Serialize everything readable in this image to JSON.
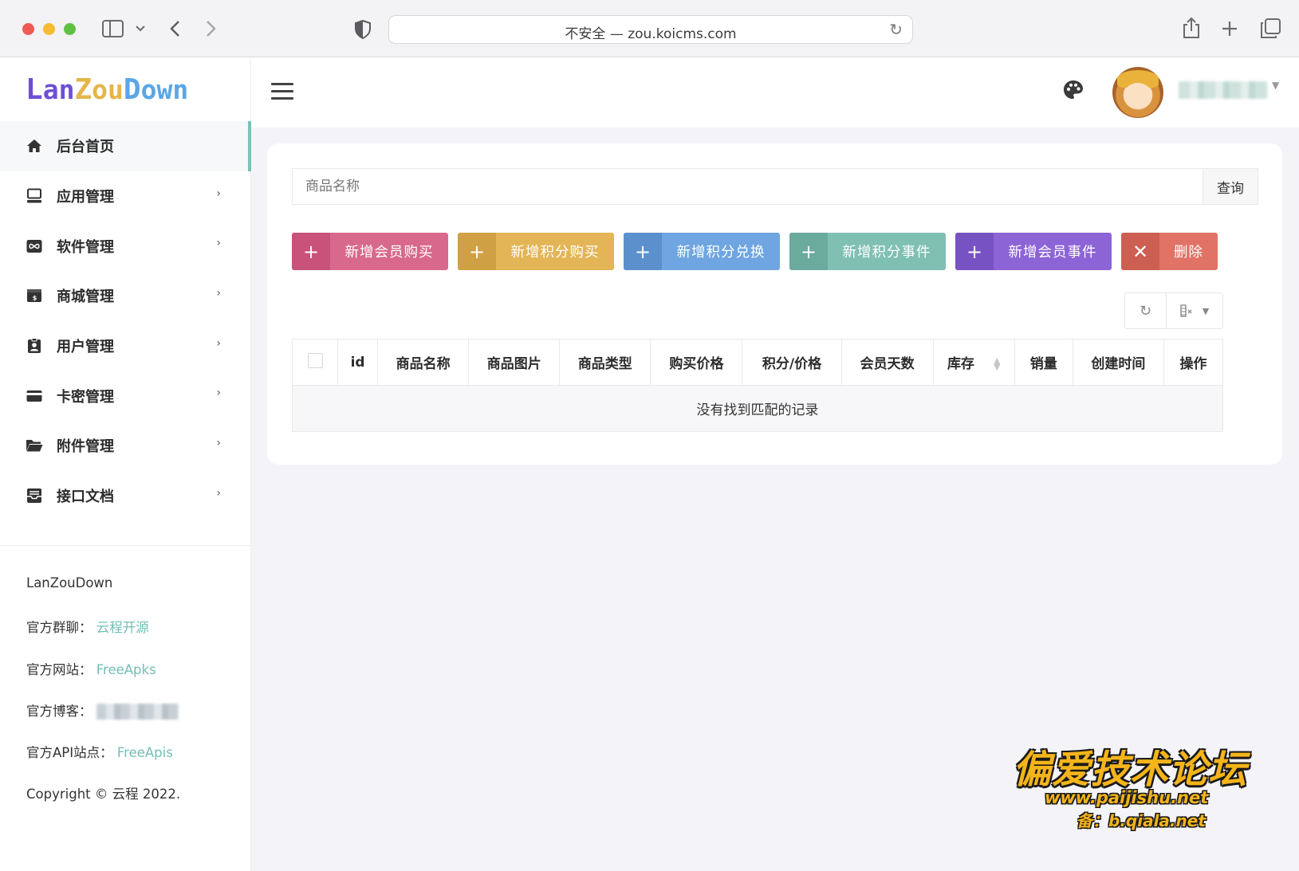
{
  "browser": {
    "address": "不安全 — zou.koicms.com"
  },
  "sidebar": {
    "logo": [
      "L",
      "a",
      "n",
      "Z",
      "o",
      "u",
      "D",
      "o",
      "w",
      "n"
    ],
    "logo_colors": [
      "#6d4fd6",
      "#6d4fd6",
      "#6d4fd6",
      "#e5b54a",
      "#e5b54a",
      "#e5b54a",
      "#5aa6e8",
      "#5aa6e8",
      "#5aa6e8",
      "#5aa6e8"
    ],
    "items": [
      {
        "label": "后台首页",
        "icon": "home-icon",
        "active": true
      },
      {
        "label": "应用管理",
        "icon": "app-icon"
      },
      {
        "label": "软件管理",
        "icon": "infinity-icon"
      },
      {
        "label": "商城管理",
        "icon": "store-icon"
      },
      {
        "label": "用户管理",
        "icon": "user-badge-icon"
      },
      {
        "label": "卡密管理",
        "icon": "card-icon"
      },
      {
        "label": "附件管理",
        "icon": "folder-icon"
      },
      {
        "label": "接口文档",
        "icon": "inbox-icon"
      }
    ],
    "footer": {
      "brand": "LanZouDown",
      "group_label": "官方群聊：",
      "group_link": "云程开源",
      "site_label": "官方网站：",
      "site_link": "FreeApks",
      "blog_label": "官方博客：",
      "api_label": "官方API站点：",
      "api_link": "FreeApis",
      "copyright": "Copyright © 云程 2022."
    }
  },
  "search": {
    "placeholder": "商品名称",
    "button": "查询"
  },
  "actions": [
    {
      "label": "新增会员购买",
      "icon": "+",
      "color": "#d8698c",
      "dark": "#c8527a"
    },
    {
      "label": "新增积分购买",
      "icon": "+",
      "color": "#e4b556",
      "dark": "#d0a044"
    },
    {
      "label": "新增积分兑换",
      "icon": "+",
      "color": "#6fa5e0",
      "dark": "#5b90cc"
    },
    {
      "label": "新增积分事件",
      "icon": "+",
      "color": "#7fc0b3",
      "dark": "#6aab9e"
    },
    {
      "label": "新增会员事件",
      "icon": "+",
      "color": "#8c64d6",
      "dark": "#7752c2"
    },
    {
      "label": "删除",
      "icon": "✕",
      "color": "#e17266",
      "dark": "#cd5e52"
    }
  ],
  "table": {
    "columns": [
      "id",
      "商品名称",
      "商品图片",
      "商品类型",
      "购买价格",
      "积分/价格",
      "会员天数",
      "库存",
      "销量",
      "创建时间",
      "操作"
    ],
    "empty_text": "没有找到匹配的记录"
  },
  "watermark": {
    "title": "偏爱技术论坛",
    "line1": "www.paijishu.net",
    "line2": "备：b.qiala.net"
  }
}
